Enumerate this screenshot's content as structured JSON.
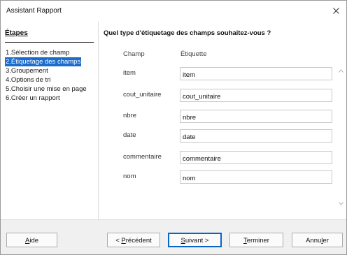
{
  "window": {
    "title": "Assistant Rapport"
  },
  "sidebar": {
    "heading": "Étapes",
    "items": [
      {
        "label": "1.Sélection de champ",
        "active": false
      },
      {
        "label": "2.Étiquetage des champs",
        "active": true
      },
      {
        "label": "3.Groupement",
        "active": false
      },
      {
        "label": "4.Options de tri",
        "active": false
      },
      {
        "label": "5.Choisir une mise en page",
        "active": false
      },
      {
        "label": "6.Créer un rapport",
        "active": false
      }
    ]
  },
  "main": {
    "question": "Quel type d'étiquetage des champs souhaitez-vous ?",
    "col_field": "Champ",
    "col_label": "Étiquette",
    "fields": [
      {
        "name": "item",
        "label": "item"
      },
      {
        "name": "cout_unitaire",
        "label": "cout_unitaire"
      },
      {
        "name": "nbre",
        "label": "nbre"
      },
      {
        "name": "date",
        "label": "date"
      },
      {
        "name": "commentaire",
        "label": "commentaire"
      },
      {
        "name": "nom",
        "label": "nom"
      }
    ]
  },
  "footer": {
    "help": {
      "pre": "",
      "key": "A",
      "post": "ide"
    },
    "back": {
      "pre": "< ",
      "key": "P",
      "post": "récédent"
    },
    "next": {
      "pre": "",
      "key": "S",
      "post": "uivant >"
    },
    "finish": {
      "pre": "",
      "key": "T",
      "post": "erminer"
    },
    "cancel": {
      "pre": "Annu",
      "key": "l",
      "post": "er"
    }
  },
  "colors": {
    "accent": "#1a6ccd",
    "focus_border": "#0a64c8"
  }
}
